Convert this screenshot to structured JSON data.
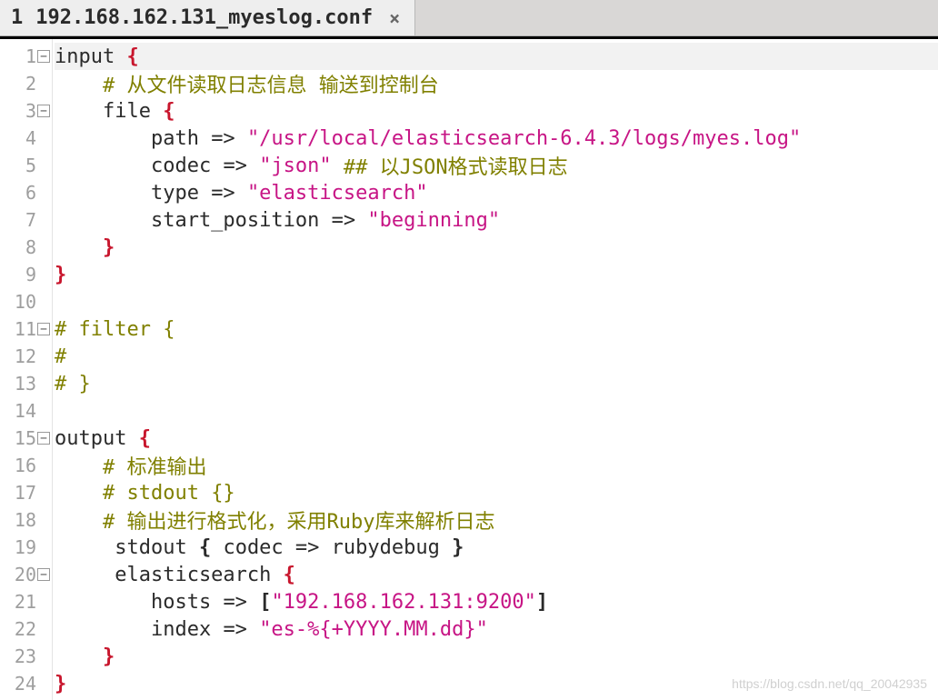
{
  "tab": {
    "index": "1",
    "title": "192.168.162.131_myeslog.conf",
    "close": "×"
  },
  "fold_minus": "⊟",
  "lines": [
    {
      "num": "1",
      "fold": true,
      "tokens": [
        [
          "kw",
          "input "
        ],
        [
          "br",
          "{"
        ]
      ],
      "highlight": true
    },
    {
      "num": "2",
      "fold": false,
      "tokens": [
        [
          "id",
          "    "
        ],
        [
          "cmt",
          "# 从文件读取日志信息 输送到控制台"
        ]
      ]
    },
    {
      "num": "3",
      "fold": true,
      "tokens": [
        [
          "id",
          "    file "
        ],
        [
          "br",
          "{"
        ]
      ]
    },
    {
      "num": "4",
      "fold": false,
      "tokens": [
        [
          "id",
          "        path "
        ],
        [
          "op",
          "=>"
        ],
        [
          "id",
          " "
        ],
        [
          "str",
          "\"/usr/local/elasticsearch-6.4.3/logs/myes.log\""
        ]
      ]
    },
    {
      "num": "5",
      "fold": false,
      "tokens": [
        [
          "id",
          "        codec "
        ],
        [
          "op",
          "=>"
        ],
        [
          "id",
          " "
        ],
        [
          "str",
          "\"json\""
        ],
        [
          "id",
          " "
        ],
        [
          "cmt",
          "## 以JSON格式读取日志"
        ]
      ]
    },
    {
      "num": "6",
      "fold": false,
      "tokens": [
        [
          "id",
          "        type "
        ],
        [
          "op",
          "=>"
        ],
        [
          "id",
          " "
        ],
        [
          "str",
          "\"elasticsearch\""
        ]
      ]
    },
    {
      "num": "7",
      "fold": false,
      "tokens": [
        [
          "id",
          "        start_position "
        ],
        [
          "op",
          "=>"
        ],
        [
          "id",
          " "
        ],
        [
          "str",
          "\"beginning\""
        ]
      ]
    },
    {
      "num": "8",
      "fold": false,
      "tokens": [
        [
          "id",
          "    "
        ],
        [
          "br",
          "}"
        ]
      ]
    },
    {
      "num": "9",
      "fold": false,
      "tokens": [
        [
          "br",
          "}"
        ]
      ]
    },
    {
      "num": "10",
      "fold": false,
      "tokens": [
        [
          "id",
          ""
        ]
      ]
    },
    {
      "num": "11",
      "fold": true,
      "tokens": [
        [
          "cmt",
          "# filter {"
        ]
      ]
    },
    {
      "num": "12",
      "fold": false,
      "tokens": [
        [
          "cmt",
          "#"
        ]
      ]
    },
    {
      "num": "13",
      "fold": false,
      "tokens": [
        [
          "cmt",
          "# }"
        ]
      ]
    },
    {
      "num": "14",
      "fold": false,
      "tokens": [
        [
          "id",
          ""
        ]
      ]
    },
    {
      "num": "15",
      "fold": true,
      "tokens": [
        [
          "kw",
          "output "
        ],
        [
          "br",
          "{"
        ]
      ]
    },
    {
      "num": "16",
      "fold": false,
      "tokens": [
        [
          "id",
          "    "
        ],
        [
          "cmt",
          "# 标准输出"
        ]
      ]
    },
    {
      "num": "17",
      "fold": false,
      "tokens": [
        [
          "id",
          "    "
        ],
        [
          "cmt",
          "# stdout {}"
        ]
      ]
    },
    {
      "num": "18",
      "fold": false,
      "tokens": [
        [
          "id",
          "    "
        ],
        [
          "cmt",
          "# 输出进行格式化，采用Ruby库来解析日志"
        ]
      ]
    },
    {
      "num": "19",
      "fold": false,
      "tokens": [
        [
          "id",
          "     stdout "
        ],
        [
          "nbr",
          "{"
        ],
        [
          "id",
          " codec "
        ],
        [
          "op",
          "=>"
        ],
        [
          "id",
          " rubydebug "
        ],
        [
          "nbr",
          "}"
        ]
      ]
    },
    {
      "num": "20",
      "fold": true,
      "tokens": [
        [
          "id",
          "     elasticsearch "
        ],
        [
          "br",
          "{"
        ]
      ]
    },
    {
      "num": "21",
      "fold": false,
      "tokens": [
        [
          "id",
          "        hosts "
        ],
        [
          "op",
          "=>"
        ],
        [
          "id",
          " "
        ],
        [
          "nbr",
          "["
        ],
        [
          "str",
          "\"192.168.162.131:9200\""
        ],
        [
          "nbr",
          "]"
        ]
      ]
    },
    {
      "num": "22",
      "fold": false,
      "tokens": [
        [
          "id",
          "        index "
        ],
        [
          "op",
          "=>"
        ],
        [
          "id",
          " "
        ],
        [
          "str",
          "\"es-%{+YYYY.MM.dd}\""
        ]
      ]
    },
    {
      "num": "23",
      "fold": false,
      "tokens": [
        [
          "id",
          "    "
        ],
        [
          "br",
          "}"
        ]
      ]
    },
    {
      "num": "24",
      "fold": false,
      "tokens": [
        [
          "br",
          "}"
        ]
      ]
    }
  ],
  "watermark": "https://blog.csdn.net/qq_20042935"
}
